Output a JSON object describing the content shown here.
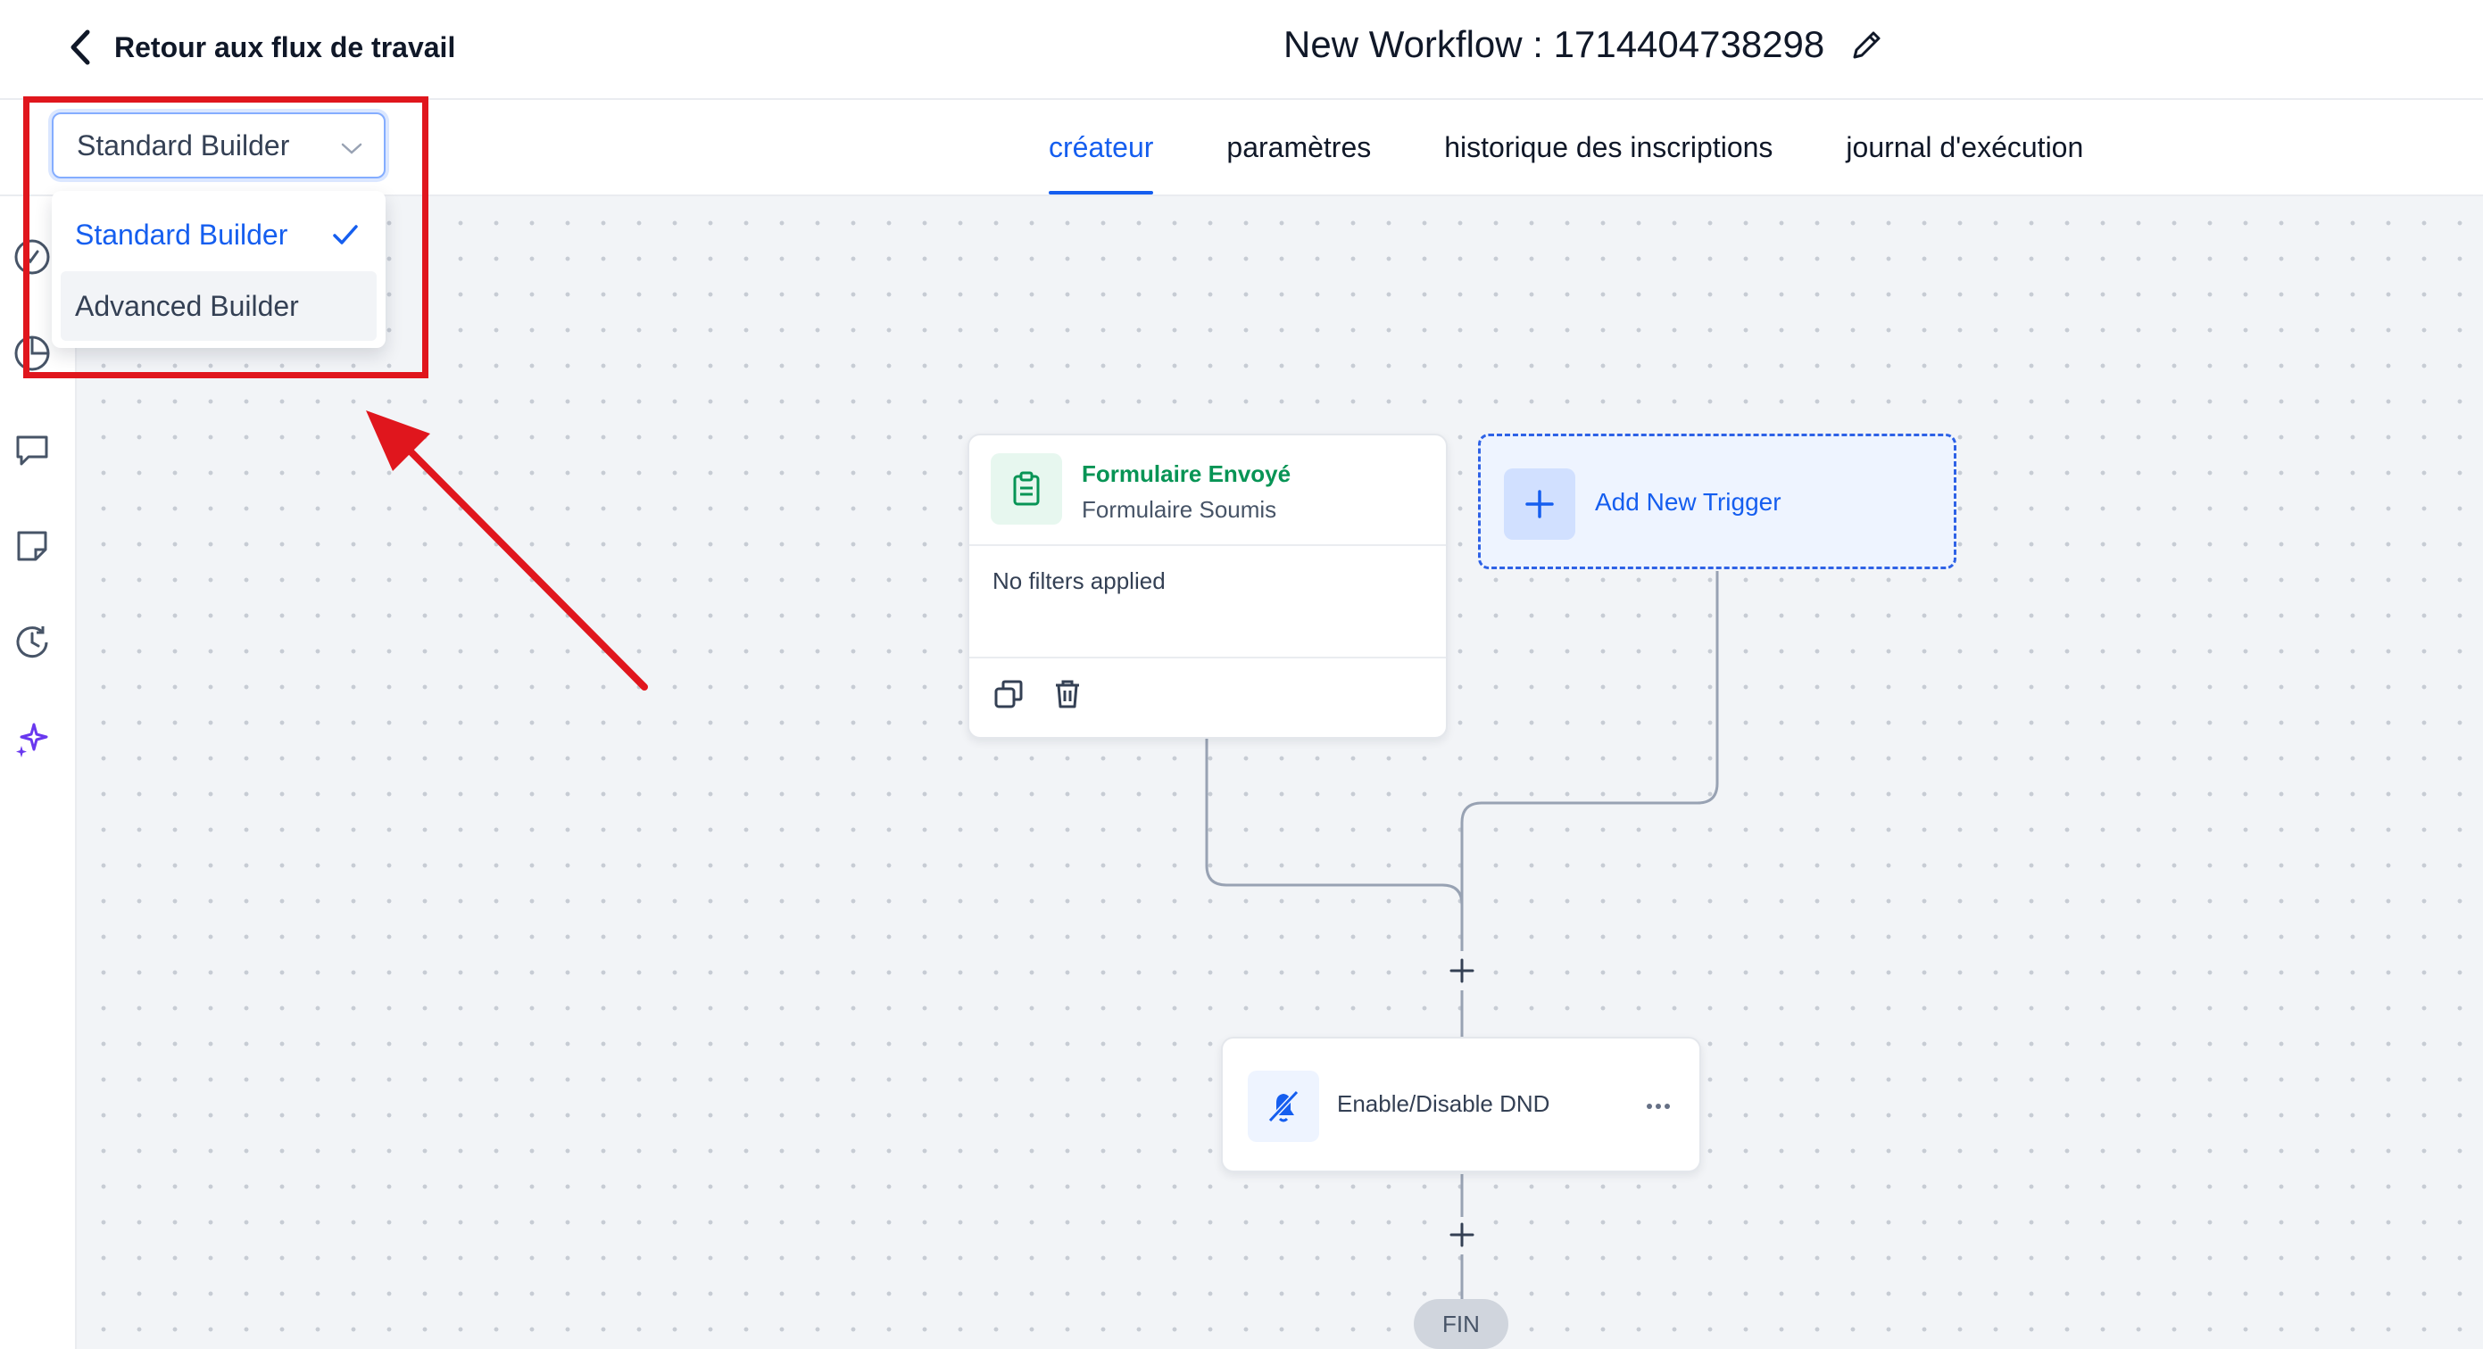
{
  "header": {
    "back_label": "Retour aux flux de travail",
    "workflow_title": "New Workflow : 1714404738298"
  },
  "tabs": [
    {
      "label": "créateur",
      "active": true
    },
    {
      "label": "paramètres",
      "active": false
    },
    {
      "label": "historique des inscriptions",
      "active": false
    },
    {
      "label": "journal d'exécution",
      "active": false
    }
  ],
  "builder_select": {
    "value": "Standard Builder",
    "options": [
      {
        "label": "Standard Builder",
        "selected": true
      },
      {
        "label": "Advanced Builder",
        "selected": false
      }
    ]
  },
  "sidebar_icons": [
    "check-circle-icon",
    "pie-chart-icon",
    "message-icon",
    "note-icon",
    "history-icon",
    "sparkles-icon"
  ],
  "trigger_card": {
    "title": "Formulaire Envoyé",
    "subtitle": "Formulaire Soumis",
    "filters": "No filters applied",
    "icon": "clipboard-icon"
  },
  "add_trigger": {
    "label": "Add New Trigger"
  },
  "action_card": {
    "label": "Enable/Disable DND",
    "icon": "bell-off-icon"
  },
  "end_label": "FIN",
  "colors": {
    "accent": "#155eef",
    "trigger_green": "#079455",
    "annotation_red": "#e0161d",
    "canvas_bg": "#f2f4f7"
  }
}
